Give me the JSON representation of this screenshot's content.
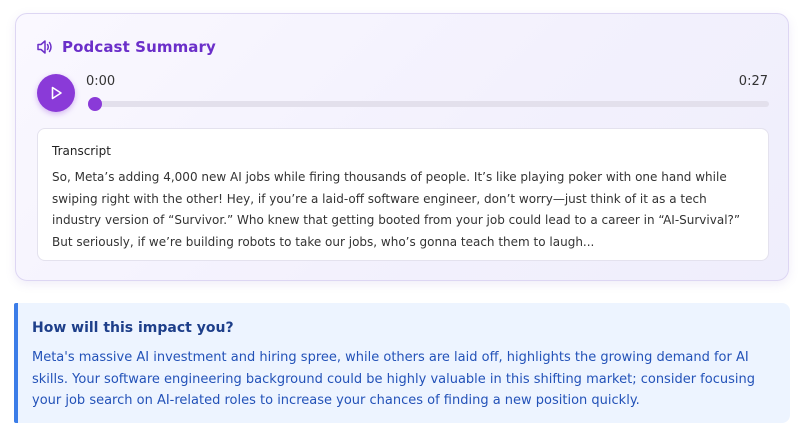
{
  "podcast": {
    "title": "Podcast Summary",
    "title_icon": "speaker-icon",
    "player": {
      "play_icon": "play-icon",
      "current_time": "0:00",
      "total_time": "0:27",
      "progress": 0.0
    },
    "transcript": {
      "label": "Transcript",
      "text": "So, Meta’s adding 4,000 new AI jobs while firing thousands of people. It’s like playing poker with one hand while swiping right with the other! Hey, if you’re a laid-off software engineer, don’t worry—just think of it as a tech industry version of “Survivor.” Who knew that getting booted from your job could lead to a career in “AI-Survival?” But seriously, if we’re building robots to take our jobs, who’s gonna teach them to laugh..."
    }
  },
  "impact": {
    "title": "How will this impact you?",
    "text": "Meta's massive AI investment and hiring spree, while others are laid off, highlights the growing demand for AI skills. Your software engineering background could be highly valuable in this shifting market; consider focusing your job search on AI-related roles to increase your chances of finding a new position quickly."
  },
  "colors": {
    "accent": "#8a3ad8",
    "title": "#6b2fc9",
    "impact_border": "#3b7de8",
    "impact_text": "#2352b8",
    "impact_bg": "#edf4ff"
  }
}
